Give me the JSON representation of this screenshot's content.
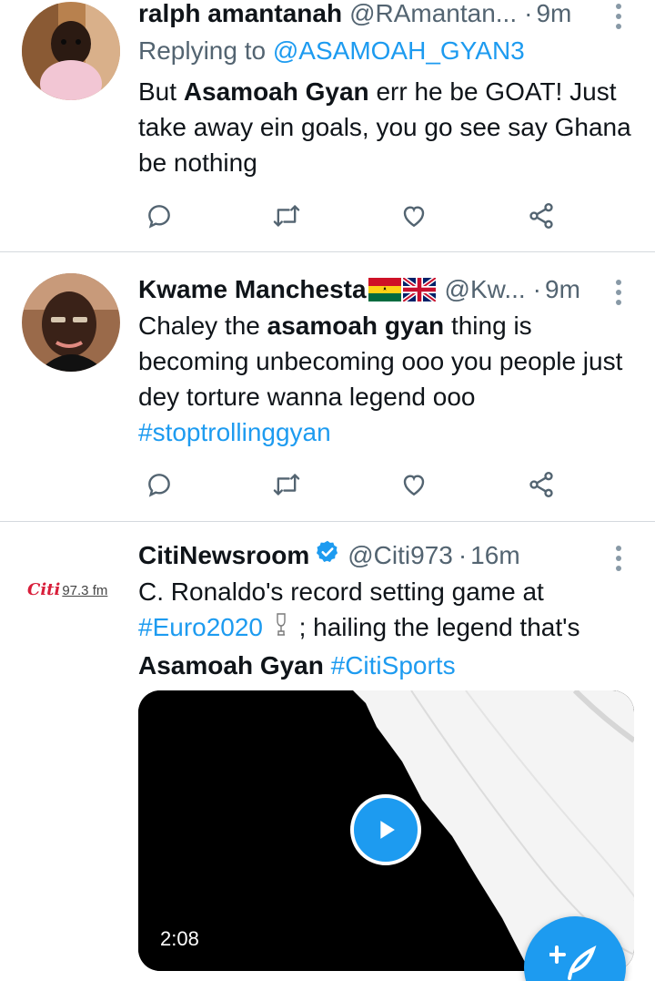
{
  "tweets": [
    {
      "name": "ralph amantanah",
      "handle": "@RAmantan...",
      "separator": "·",
      "time": "9m",
      "replying_prefix": "Replying to",
      "replying_handle": "@ASAMOAH_GYAN3",
      "text_parts": [
        "But ",
        "Asamoah Gyan",
        " err he be GOAT! Just take away ein goals, you go see say Ghana be nothing"
      ]
    },
    {
      "name": "Kwame Manchesta",
      "handle": "@Kw...",
      "separator": "·",
      "time": "9m",
      "flags": [
        "ghana-flag-icon",
        "uk-flag-icon"
      ],
      "text_parts": [
        "Chaley the ",
        "asamoah gyan",
        " thing is becoming unbecoming ooo you people just dey torture wanna legend ooo "
      ],
      "hashtag": "#stoptrollinggyan"
    },
    {
      "name": "CitiNewsroom",
      "handle": "@Citi973",
      "separator": "·",
      "time": "16m",
      "verified": true,
      "avatar_logo": "Citi",
      "avatar_freq": "97.3 fm",
      "text_parts": [
        "C. Ronaldo's record setting game at "
      ],
      "hashtag_1": "#Euro2020",
      "text_after_hashtag": " ; hailing the legend that's ",
      "bold_name": "Asamoah Gyan",
      "hashtag_2": "#CitiSports",
      "video_duration": "2:08"
    }
  ],
  "colors": {
    "accent": "#1d9bf0",
    "text": "#0f1419",
    "secondary": "#536471",
    "divider": "#d4d9de"
  },
  "icons": [
    "reply-icon",
    "retweet-icon",
    "like-icon",
    "share-icon",
    "more-icon",
    "verified-badge-icon",
    "play-icon",
    "compose-tweet-icon",
    "trophy-emoji-icon"
  ]
}
